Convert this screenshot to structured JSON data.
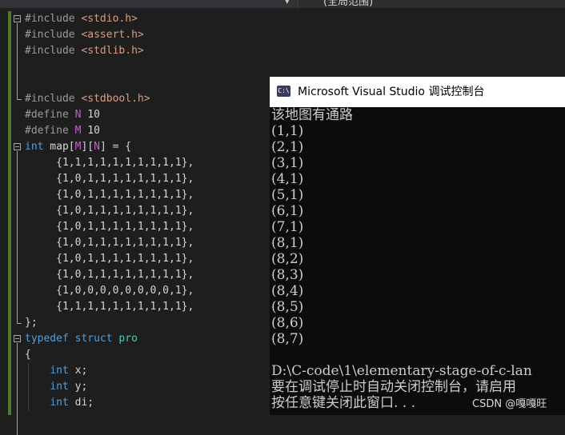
{
  "top_bar": {
    "scope_label": "(全局范围)"
  },
  "editor": {
    "lines": [
      {
        "tokens": [
          {
            "t": "#include ",
            "c": "pp"
          },
          {
            "t": "<stdio.h>",
            "c": "str"
          }
        ]
      },
      {
        "tokens": [
          {
            "t": "#include ",
            "c": "pp"
          },
          {
            "t": "<assert.h>",
            "c": "str"
          }
        ]
      },
      {
        "tokens": [
          {
            "t": "#include ",
            "c": "pp"
          },
          {
            "t": "<stdlib.h>",
            "c": "str"
          }
        ]
      },
      {
        "tokens": []
      },
      {
        "tokens": []
      },
      {
        "tokens": [
          {
            "t": "#include ",
            "c": "pp"
          },
          {
            "t": "<stdbool.h>",
            "c": "str"
          }
        ]
      },
      {
        "tokens": [
          {
            "t": "#define ",
            "c": "pp"
          },
          {
            "t": "N",
            "c": "mac"
          },
          {
            "t": " 10",
            "c": ""
          }
        ]
      },
      {
        "tokens": [
          {
            "t": "#define ",
            "c": "pp"
          },
          {
            "t": "M",
            "c": "mac"
          },
          {
            "t": " 10",
            "c": ""
          }
        ]
      },
      {
        "tokens": [
          {
            "t": "int",
            "c": "kw"
          },
          {
            "t": " map[",
            "c": ""
          },
          {
            "t": "M",
            "c": "mac"
          },
          {
            "t": "][",
            "c": ""
          },
          {
            "t": "N",
            "c": "mac"
          },
          {
            "t": "] = {",
            "c": ""
          }
        ]
      },
      {
        "tokens": [
          {
            "t": "     {1,1,1,1,1,1,1,1,1,1},",
            "c": ""
          }
        ]
      },
      {
        "tokens": [
          {
            "t": "     {1,0,1,1,1,1,1,1,1,1},",
            "c": ""
          }
        ]
      },
      {
        "tokens": [
          {
            "t": "     {1,0,1,1,1,1,1,1,1,1},",
            "c": ""
          }
        ]
      },
      {
        "tokens": [
          {
            "t": "     {1,0,1,1,1,1,1,1,1,1},",
            "c": ""
          }
        ]
      },
      {
        "tokens": [
          {
            "t": "     {1,0,1,1,1,1,1,1,1,1},",
            "c": ""
          }
        ]
      },
      {
        "tokens": [
          {
            "t": "     {1,0,1,1,1,1,1,1,1,1},",
            "c": ""
          }
        ]
      },
      {
        "tokens": [
          {
            "t": "     {1,0,1,1,1,1,1,1,1,1},",
            "c": ""
          }
        ]
      },
      {
        "tokens": [
          {
            "t": "     {1,0,1,1,1,1,1,1,1,1},",
            "c": ""
          }
        ]
      },
      {
        "tokens": [
          {
            "t": "     {1,0,0,0,0,0,0,0,0,1},",
            "c": ""
          }
        ]
      },
      {
        "tokens": [
          {
            "t": "     {1,1,1,1,1,1,1,1,1,1},",
            "c": ""
          }
        ]
      },
      {
        "tokens": [
          {
            "t": "};",
            "c": ""
          }
        ]
      },
      {
        "tokens": [
          {
            "t": "typedef",
            "c": "kw"
          },
          {
            "t": " ",
            "c": ""
          },
          {
            "t": "struct",
            "c": "kw"
          },
          {
            "t": " ",
            "c": ""
          },
          {
            "t": "pro",
            "c": "typ"
          }
        ]
      },
      {
        "tokens": [
          {
            "t": "{",
            "c": ""
          }
        ]
      },
      {
        "tokens": [
          {
            "t": "    ",
            "c": ""
          },
          {
            "t": "int",
            "c": "kw"
          },
          {
            "t": " x;",
            "c": ""
          }
        ]
      },
      {
        "tokens": [
          {
            "t": "    ",
            "c": ""
          },
          {
            "t": "int",
            "c": "kw"
          },
          {
            "t": " y;",
            "c": ""
          }
        ]
      },
      {
        "tokens": [
          {
            "t": "    ",
            "c": ""
          },
          {
            "t": "int",
            "c": "kw"
          },
          {
            "t": " di;",
            "c": ""
          }
        ]
      }
    ]
  },
  "console": {
    "title": "Microsoft Visual Studio 调试控制台",
    "icon_label": "C:\\",
    "lines": [
      "该地图有通路",
      "(1,1)",
      "(2,1)",
      "(3,1)",
      "(4,1)",
      "(5,1)",
      "(6,1)",
      "(7,1)",
      "(8,1)",
      "(8,2)",
      "(8,3)",
      "(8,4)",
      "(8,5)",
      "(8,6)",
      "(8,7)",
      "",
      "D:\\C-code\\1\\elementary-stage-of-c-lan",
      "要在调试停止时自动关闭控制台，请启用",
      "按任意键关闭此窗口. . ."
    ]
  },
  "watermark": "CSDN @嘎嘎旺"
}
